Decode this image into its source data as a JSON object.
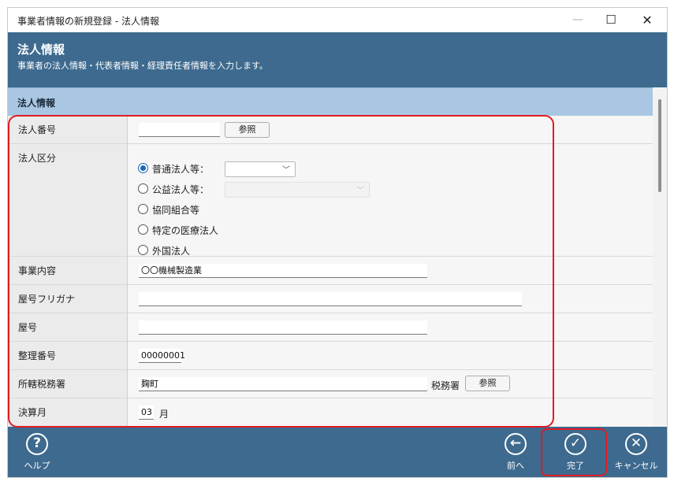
{
  "window": {
    "title": "事業者情報の新規登録 - 法人情報",
    "min_glyph": "—",
    "max_glyph": "☐",
    "close_glyph": "✕"
  },
  "header": {
    "title": "法人情報",
    "subtitle": "事業者の法人情報・代表者情報・経理責任者情報を入力します。"
  },
  "section": {
    "title": "法人情報"
  },
  "form": {
    "corp_number": {
      "label": "法人番号",
      "value": "",
      "browse": "参照"
    },
    "corp_class": {
      "label": "法人区分",
      "options": [
        {
          "label": "普通法人等：",
          "checked": true
        },
        {
          "label": "公益法人等：",
          "checked": false
        },
        {
          "label": "協同組合等",
          "checked": false
        },
        {
          "label": "特定の医療法人",
          "checked": false
        },
        {
          "label": "外国法人",
          "checked": false
        }
      ],
      "futsu_select": "",
      "koeki_select": ""
    },
    "business": {
      "label": "事業内容",
      "value": "〇〇機械製造業"
    },
    "trade_kana": {
      "label": "屋号フリガナ",
      "value": ""
    },
    "trade_name": {
      "label": "屋号",
      "value": ""
    },
    "ref_number": {
      "label": "整理番号",
      "value": "00000001"
    },
    "tax_office": {
      "label": "所轄税務署",
      "value": "麹町",
      "suffix": "税務署",
      "browse": "参照"
    },
    "fiscal_month": {
      "label": "決算月",
      "value": "03",
      "unit": "月"
    }
  },
  "footer": {
    "help": {
      "label": "ヘルプ",
      "glyph": "?"
    },
    "prev": {
      "label": "前へ",
      "glyph": "←"
    },
    "done": {
      "label": "完了",
      "glyph": "✓"
    },
    "cancel": {
      "label": "キャンセル",
      "glyph": "✕"
    }
  },
  "icons": {
    "help": "question-circle-icon",
    "prev": "arrow-left-circle-icon",
    "done": "check-circle-icon",
    "cancel": "x-circle-icon"
  },
  "colors": {
    "header": "#3d6a8e",
    "section": "#a9c7e2",
    "highlight": "#e01b24",
    "radio": "#1f65b8"
  }
}
